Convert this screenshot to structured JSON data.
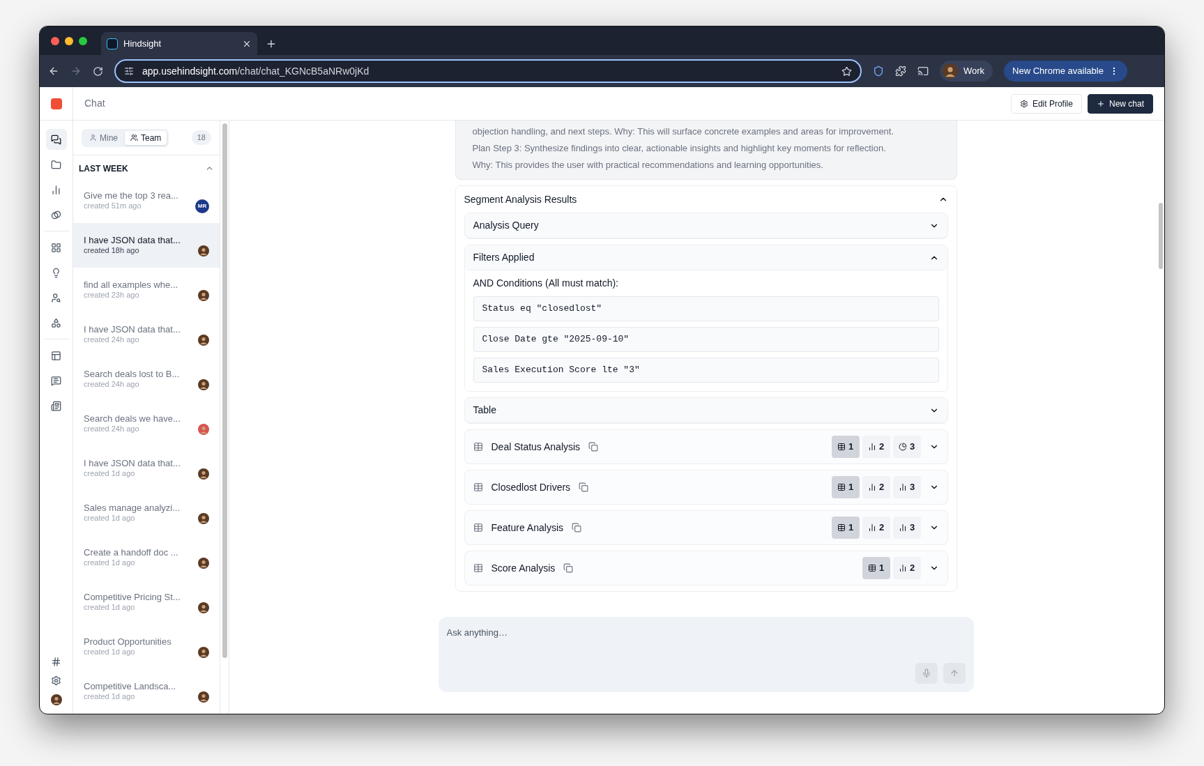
{
  "browser": {
    "tab_title": "Hindsight",
    "url_host": "app.usehindsight.com",
    "url_path": "/chat/chat_KGNcB5aNRw0jKd",
    "profile": "Work",
    "update_button": "New Chrome available"
  },
  "header": {
    "title": "Chat",
    "buttons": [
      {
        "label": "Edit Profile",
        "kind": "outline"
      },
      {
        "label": "New chat",
        "kind": "primary"
      }
    ]
  },
  "rail": {
    "groups": [
      [
        {
          "selected": true
        },
        {
          "selected": false
        },
        {
          "selected": false
        },
        {
          "selected": false
        }
      ],
      [
        {
          "selected": false
        },
        {
          "selected": false
        },
        {
          "selected": false
        },
        {
          "selected": false
        }
      ],
      [
        {
          "selected": false
        },
        {
          "selected": false
        },
        {
          "selected": false
        }
      ]
    ]
  },
  "chat_list": {
    "scopes": [
      {
        "label": "Mine",
        "selected": false
      },
      {
        "label": "Team",
        "selected": true
      }
    ],
    "count": "18",
    "section": {
      "title": "LAST WEEK",
      "expanded": true
    },
    "items": [
      {
        "title": "Give me the top 3 rea...",
        "meta": "created 51m ago",
        "selected": false,
        "avatar": {
          "kind": "initials",
          "initials": "MR"
        }
      },
      {
        "title": "I have JSON data that...",
        "meta": "created 18h ago",
        "selected": true,
        "avatar": {
          "kind": "photo",
          "color": "#5b3a24"
        }
      },
      {
        "title": "find all examples whe...",
        "meta": "created 23h ago",
        "selected": false,
        "avatar": {
          "kind": "photo",
          "color": "#5b3a24"
        }
      },
      {
        "title": "I have JSON data that...",
        "meta": "created 24h ago",
        "selected": false,
        "avatar": {
          "kind": "photo",
          "color": "#5b3a24"
        }
      },
      {
        "title": "Search deals lost to B...",
        "meta": "created 24h ago",
        "selected": false,
        "avatar": {
          "kind": "photo",
          "color": "#5b3a24"
        }
      },
      {
        "title": "Search deals we have...",
        "meta": "created 24h ago",
        "selected": false,
        "avatar": {
          "kind": "photo",
          "color": "#d9534f"
        }
      },
      {
        "title": "I have JSON data that...",
        "meta": "created 1d ago",
        "selected": false,
        "avatar": {
          "kind": "photo",
          "color": "#5b3a24"
        }
      },
      {
        "title": "Sales manage analyzi...",
        "meta": "created 1d ago",
        "selected": false,
        "avatar": {
          "kind": "photo",
          "color": "#5b3a24"
        }
      },
      {
        "title": "Create a handoff doc ...",
        "meta": "created 1d ago",
        "selected": false,
        "avatar": {
          "kind": "photo",
          "color": "#5b3a24"
        }
      },
      {
        "title": "Competitive Pricing St...",
        "meta": "created 1d ago",
        "selected": false,
        "avatar": {
          "kind": "photo",
          "color": "#5b3a24"
        }
      },
      {
        "title": "Product Opportunities",
        "meta": "created 1d ago",
        "selected": false,
        "avatar": {
          "kind": "photo",
          "color": "#5b3a24"
        }
      },
      {
        "title": "Competitive Landsca...",
        "meta": "created 1d ago",
        "selected": false,
        "avatar": {
          "kind": "photo",
          "color": "#5b3a24"
        }
      }
    ]
  },
  "reasoning": {
    "lines": [
      "objection handling, and next steps. Why: This will surface concrete examples and areas for improvement.",
      "Plan Step 3: Synthesize findings into clear, actionable insights and highlight key moments for reflection.",
      "Why: This provides the user with practical recommendations and learning opportunities."
    ]
  },
  "results": {
    "title": "Segment Analysis Results",
    "expanded": true,
    "sections": [
      {
        "title": "Analysis Query",
        "expanded": false
      },
      {
        "title": "Filters Applied",
        "expanded": true,
        "heading": "AND Conditions (All must match):",
        "conditions": [
          "Status eq \"closedlost\"",
          "Close Date gte \"2025-09-10\"",
          "Sales Execution Score lte \"3\""
        ]
      },
      {
        "title": "Table",
        "expanded": false
      }
    ],
    "analyses": [
      {
        "title": "Deal Status Analysis",
        "expanded": false,
        "views": [
          {
            "kind": "table",
            "label": "1",
            "selected": true
          },
          {
            "kind": "bar",
            "label": "2",
            "selected": false
          },
          {
            "kind": "pie",
            "label": "3",
            "selected": false
          }
        ]
      },
      {
        "title": "Closedlost Drivers",
        "expanded": false,
        "views": [
          {
            "kind": "table",
            "label": "1",
            "selected": true
          },
          {
            "kind": "bar",
            "label": "2",
            "selected": false
          },
          {
            "kind": "bar",
            "label": "3",
            "selected": false
          }
        ]
      },
      {
        "title": "Feature Analysis",
        "expanded": false,
        "views": [
          {
            "kind": "table",
            "label": "1",
            "selected": true
          },
          {
            "kind": "bar",
            "label": "2",
            "selected": false
          },
          {
            "kind": "bar",
            "label": "3",
            "selected": false
          }
        ]
      },
      {
        "title": "Score Analysis",
        "expanded": false,
        "views": [
          {
            "kind": "table",
            "label": "1",
            "selected": true
          },
          {
            "kind": "bar",
            "label": "2",
            "selected": false
          }
        ]
      }
    ]
  },
  "composer": {
    "placeholder": "Ask anything…"
  }
}
